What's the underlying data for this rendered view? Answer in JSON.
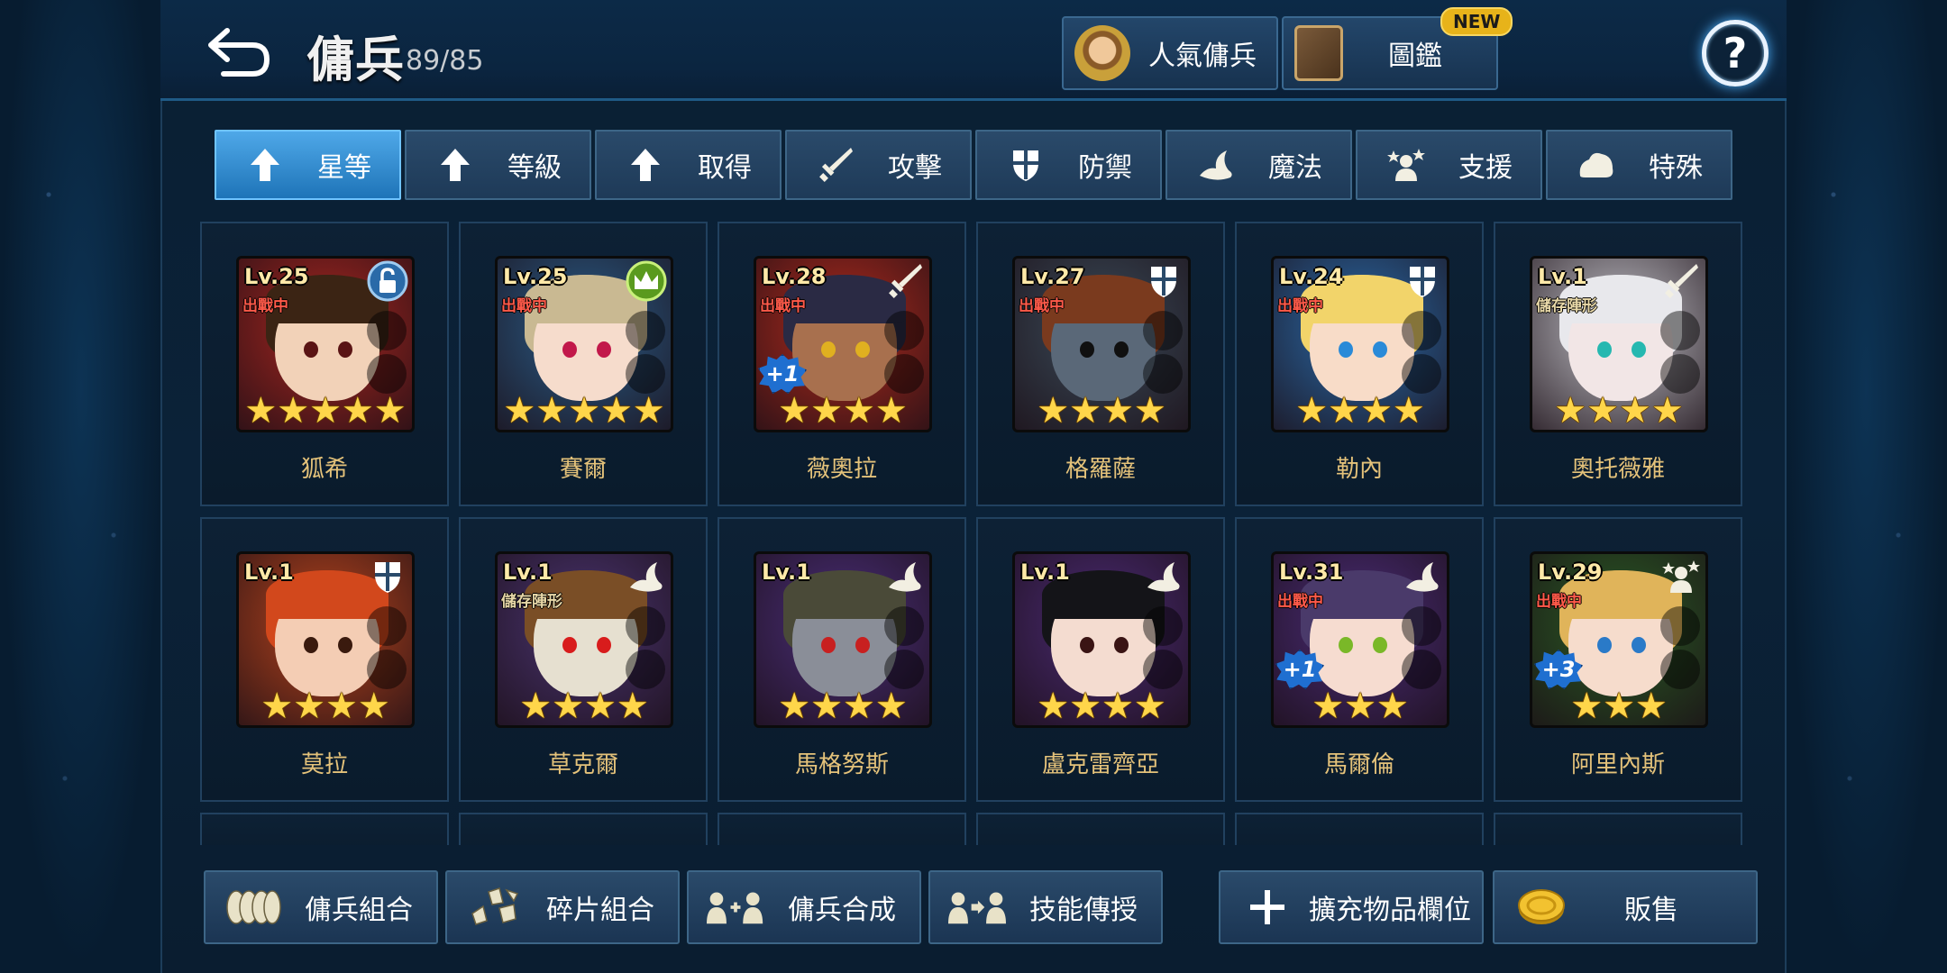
{
  "header": {
    "title": "傭兵",
    "count": "89/85",
    "popular_label": "人氣傭兵",
    "book_label": "圖鑑",
    "new_badge": "NEW",
    "help_label": "?"
  },
  "tabs": [
    {
      "label": "星等",
      "icon": "arrow-up-icon",
      "active": true
    },
    {
      "label": "等級",
      "icon": "arrow-up-icon",
      "active": false
    },
    {
      "label": "取得",
      "icon": "arrow-up-icon",
      "active": false
    },
    {
      "label": "攻擊",
      "icon": "sword-icon",
      "active": false
    },
    {
      "label": "防禦",
      "icon": "shield-icon",
      "active": false
    },
    {
      "label": "魔法",
      "icon": "wizard-hat-icon",
      "active": false
    },
    {
      "label": "支援",
      "icon": "support-icon",
      "active": false
    },
    {
      "label": "特殊",
      "icon": "blob-icon",
      "active": false
    }
  ],
  "mercenaries": [
    {
      "name": "狐希",
      "level": "Lv.25",
      "status": "出戰中",
      "stars": 5,
      "role": "lock-icon",
      "plus": "",
      "palette": {
        "bg": "#a8261f",
        "hair": "#3b2414",
        "skin": "#f2d2b8",
        "eye": "#5a1414"
      }
    },
    {
      "name": "賽爾",
      "level": "Lv.25",
      "status": "出戰中",
      "stars": 5,
      "role": "crown-icon",
      "plus": "",
      "palette": {
        "bg": "#2a5c88",
        "hair": "#c9b992",
        "skin": "#f6dccc",
        "eye": "#c2184a"
      }
    },
    {
      "name": "薇奧拉",
      "level": "Lv.28",
      "status": "出戰中",
      "stars": 4,
      "role": "sword-icon",
      "plus": "+1",
      "palette": {
        "bg": "#b02a1c",
        "hair": "#2a2a44",
        "skin": "#a8704e",
        "eye": "#e0b020"
      }
    },
    {
      "name": "格羅薩",
      "level": "Lv.27",
      "status": "出戰中",
      "stars": 4,
      "role": "shield-icon",
      "plus": "",
      "palette": {
        "bg": "#3a4a58",
        "hair": "#7a3a1e",
        "skin": "#5a6878",
        "eye": "#101010"
      }
    },
    {
      "name": "勒內",
      "level": "Lv.24",
      "status": "出戰中",
      "stars": 4,
      "role": "shield-icon",
      "plus": "",
      "palette": {
        "bg": "#2a6aa8",
        "hair": "#f2d46a",
        "skin": "#f8dcc8",
        "eye": "#2a8ad8"
      }
    },
    {
      "name": "奧托薇雅",
      "level": "Lv.1",
      "status": "儲存陣形",
      "stars": 4,
      "role": "sword-icon",
      "plus": "",
      "palette": {
        "bg": "#c2c2c8",
        "hair": "#e8e8ec",
        "skin": "#f2e6e6",
        "eye": "#26b8b0"
      }
    },
    {
      "name": "莫拉",
      "level": "Lv.1",
      "status": "",
      "stars": 4,
      "role": "shield-icon",
      "plus": "",
      "palette": {
        "bg": "#b8441c",
        "hair": "#d2481c",
        "skin": "#f4cdb4",
        "eye": "#3a1a0e"
      }
    },
    {
      "name": "草克爾",
      "level": "Lv.1",
      "status": "儲存陣形",
      "stars": 4,
      "role": "wizard-hat-icon",
      "plus": "",
      "palette": {
        "bg": "#4a3470",
        "hair": "#7a4e26",
        "skin": "#e6e0d0",
        "eye": "#d81c1c"
      }
    },
    {
      "name": "馬格努斯",
      "level": "Lv.1",
      "status": "",
      "stars": 4,
      "role": "wizard-hat-icon",
      "plus": "",
      "palette": {
        "bg": "#4a2e78",
        "hair": "#4a4a38",
        "skin": "#8a8e98",
        "eye": "#c82020"
      }
    },
    {
      "name": "盧克雷齊亞",
      "level": "Lv.1",
      "status": "",
      "stars": 4,
      "role": "wizard-hat-icon",
      "plus": "",
      "palette": {
        "bg": "#4a2a72",
        "hair": "#141418",
        "skin": "#f4dcd0",
        "eye": "#3a1414"
      }
    },
    {
      "name": "馬爾倫",
      "level": "Lv.31",
      "status": "出戰中",
      "stars": 3,
      "role": "wizard-hat-icon",
      "plus": "+1",
      "palette": {
        "bg": "#4a2c76",
        "hair": "#4a3a6a",
        "skin": "#f6dcd0",
        "eye": "#7ab828"
      }
    },
    {
      "name": "阿里內斯",
      "level": "Lv.29",
      "status": "出戰中",
      "stars": 3,
      "role": "support-icon",
      "plus": "+3",
      "palette": {
        "bg": "#2a5a24",
        "hair": "#e0b45a",
        "skin": "#f6dccc",
        "eye": "#2a7ac8"
      }
    }
  ],
  "bottom": {
    "combine_label": "傭兵組合",
    "shard_label": "碎片組合",
    "synth_label": "傭兵合成",
    "skill_label": "技能傳授",
    "expand_label": "擴充物品欄位",
    "sell_label": "販售"
  },
  "colors": {
    "accent": "#4fa8e8",
    "name_text": "#e4c27a",
    "status_active": "#ff5a4a",
    "star": "#ffd64a"
  }
}
